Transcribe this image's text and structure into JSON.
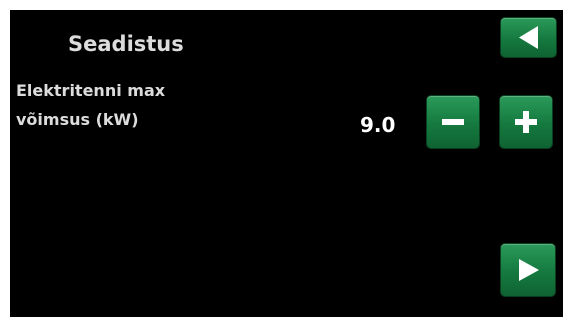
{
  "header": {
    "title": "Seadistus",
    "back_icon": "triangle-left-icon"
  },
  "setting": {
    "label_line1": "Elektritenni max",
    "label_line2": "võimsus (kW)",
    "value": "9.0",
    "decrease_icon": "minus-icon",
    "increase_icon": "plus-icon"
  },
  "footer": {
    "next_icon": "triangle-right-icon"
  },
  "colors": {
    "background": "#000000",
    "button_green": "#15793f",
    "text": "#dcdcdc",
    "icon": "#ffffff"
  }
}
